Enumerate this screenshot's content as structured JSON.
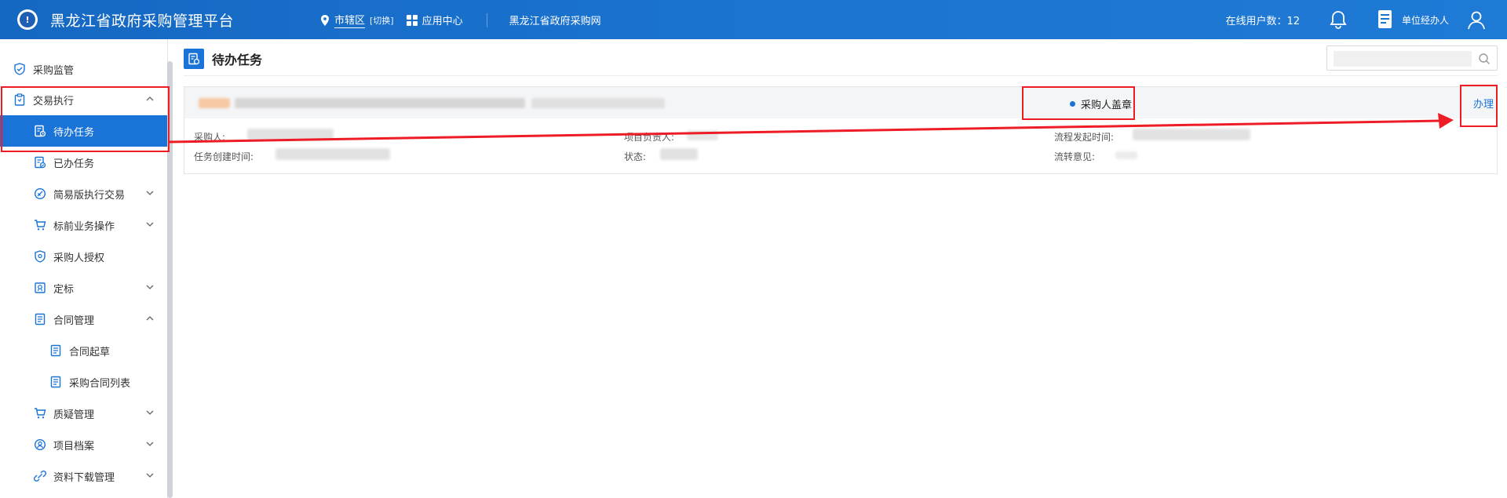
{
  "header": {
    "logo_text": "!",
    "title": "黑龙江省政府采购管理平台",
    "region_label": "市辖区",
    "switch_label": "[切换]",
    "app_center_label": "应用中心",
    "portal_label": "黑龙江省政府采购网",
    "online_users_label": "在线用户数：12",
    "user_role": "单位经办人"
  },
  "sidebar": {
    "items": [
      {
        "label": "采购监管",
        "icon": "shield-check-icon"
      },
      {
        "label": "交易执行",
        "icon": "clipboard-icon"
      },
      {
        "label": "待办任务",
        "icon": "task-doc-icon"
      },
      {
        "label": "已办任务",
        "icon": "done-doc-icon"
      },
      {
        "label": "简易版执行交易",
        "icon": "circle-slash-icon"
      },
      {
        "label": "标前业务操作",
        "icon": "cart-icon"
      },
      {
        "label": "采购人授权",
        "icon": "shield-key-icon"
      },
      {
        "label": "定标",
        "icon": "award-doc-icon"
      },
      {
        "label": "合同管理",
        "icon": "list-doc-icon"
      },
      {
        "label": "合同起草",
        "icon": "list-doc-icon"
      },
      {
        "label": "采购合同列表",
        "icon": "list-doc-icon"
      },
      {
        "label": "质疑管理",
        "icon": "cart-icon"
      },
      {
        "label": "项目档案",
        "icon": "user-circle-icon"
      },
      {
        "label": "资料下载管理",
        "icon": "link-icon"
      }
    ]
  },
  "page": {
    "title": "待办任务",
    "search_placeholder": ""
  },
  "task": {
    "status": "采购人盖章",
    "action_label": "办理",
    "purchaser_label": "采购人:",
    "project_leader_label": "项目负责人:",
    "flow_start_time_label": "流程发起时间:",
    "task_created_time_label": "任务创建时间:",
    "state_label": "状态:",
    "flow_opinion_label": "流转意见:"
  },
  "colors": {
    "primary": "#1a73d6",
    "annotation": "#ee1c25"
  }
}
